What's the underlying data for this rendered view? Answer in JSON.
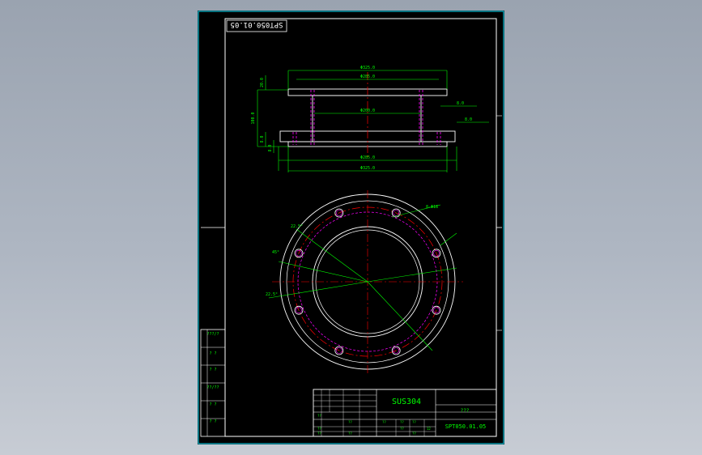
{
  "drawing": {
    "drawing_no_rotated": "SPT050.01.05",
    "drawing_no": "SPT050.01.05",
    "material": "SUS304",
    "title_placeholder": "???",
    "side_labels": [
      "???/?",
      "? ?",
      "? ?",
      "??/??",
      "? ?",
      "? ?"
    ],
    "title_block_small": [
      "??",
      "??",
      "??",
      "??",
      "??",
      "??",
      "??",
      "??",
      "??",
      "??",
      "12"
    ]
  },
  "dimensions": {
    "top_outer": "Φ325.0",
    "top_bcd": "Φ285.0",
    "height_total": "100.0",
    "flange_thk": "20.0",
    "body_inner": "Φ200.0",
    "bottom_bcd": "Φ285.0",
    "bottom_outer": "Φ325.0",
    "step_a": "8.0",
    "step_b": "8.0",
    "hole_note": "8-Φ18",
    "angle_1": "22.5°",
    "angle_2": "45°",
    "angle_3": "22.5°"
  },
  "colors": {
    "sheet_bg": "#000000",
    "frame": "#ffffff",
    "dimension": "#00ff00",
    "centerline": "#ff0000",
    "hidden": "#ff00ff",
    "text": "#00ff00"
  }
}
